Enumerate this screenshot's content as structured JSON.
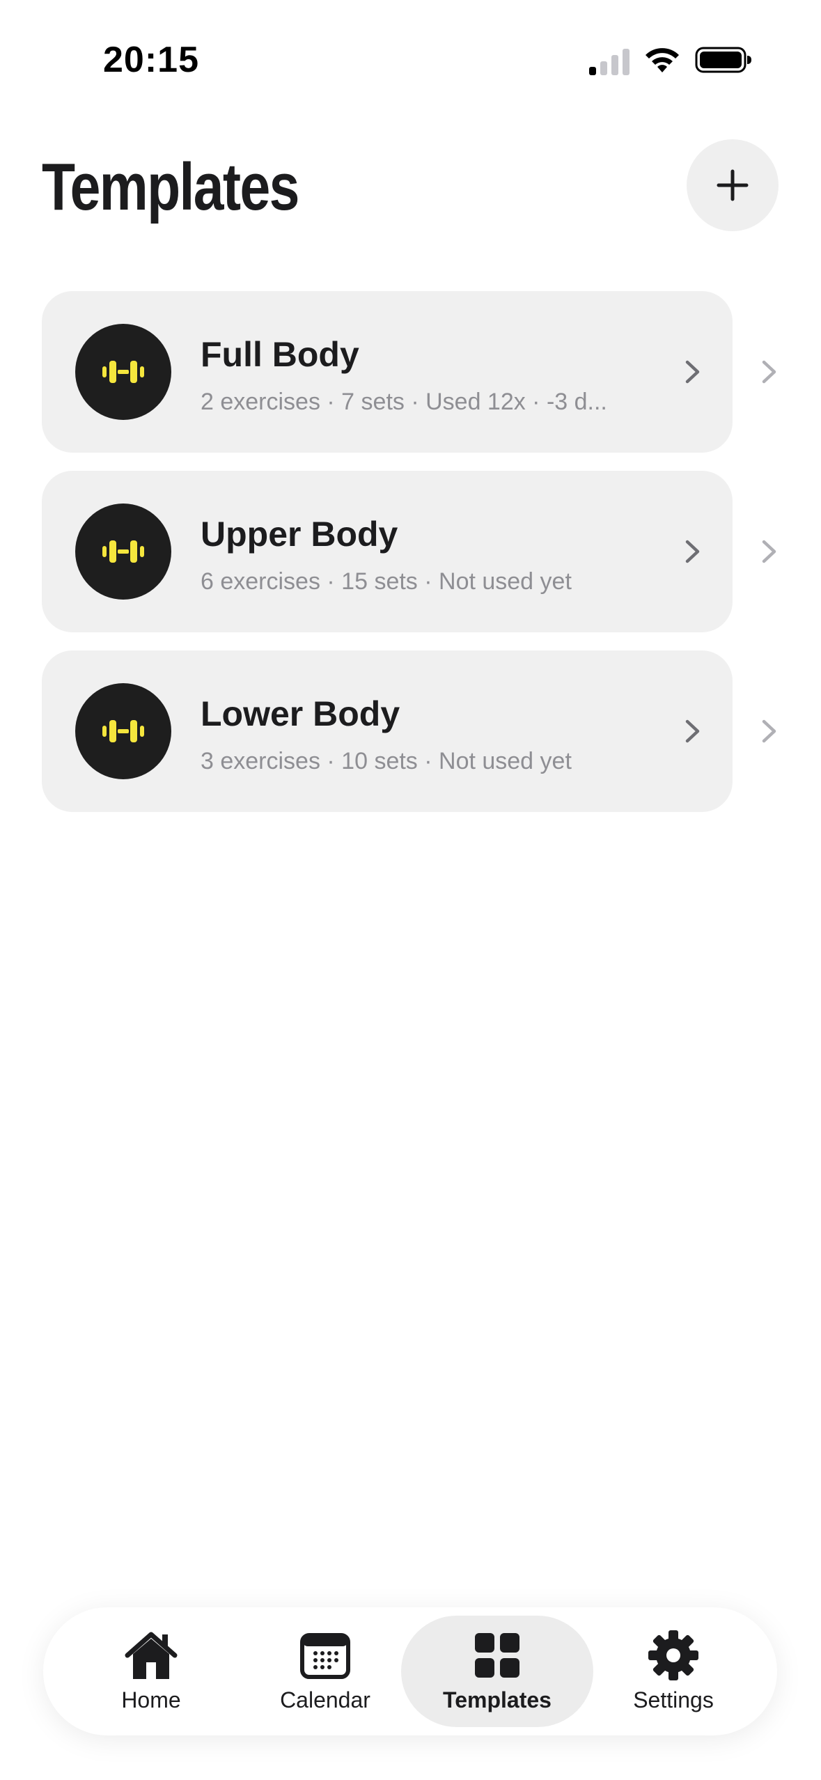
{
  "status_bar": {
    "time": "20:15"
  },
  "header": {
    "title": "Templates"
  },
  "colors": {
    "accent": "#f5e63d",
    "card_background": "#f0f0f0",
    "icon_circle": "#1e1e1e",
    "meta_text": "#8e8e93"
  },
  "templates": [
    {
      "name": "Full Body",
      "meta": "2 exercises · 7 sets · Used 12x · -3 d...",
      "icon": "dumbbell-icon"
    },
    {
      "name": "Upper Body",
      "meta": "6 exercises · 15 sets · Not used yet",
      "icon": "dumbbell-icon"
    },
    {
      "name": "Lower Body",
      "meta": "3 exercises · 10 sets · Not used yet",
      "icon": "dumbbell-icon"
    }
  ],
  "tab_bar": {
    "tabs": [
      {
        "label": "Home",
        "icon": "home-icon"
      },
      {
        "label": "Calendar",
        "icon": "calendar-icon"
      },
      {
        "label": "Templates",
        "icon": "grid-icon",
        "active": true
      },
      {
        "label": "Settings",
        "icon": "gear-icon"
      }
    ]
  }
}
